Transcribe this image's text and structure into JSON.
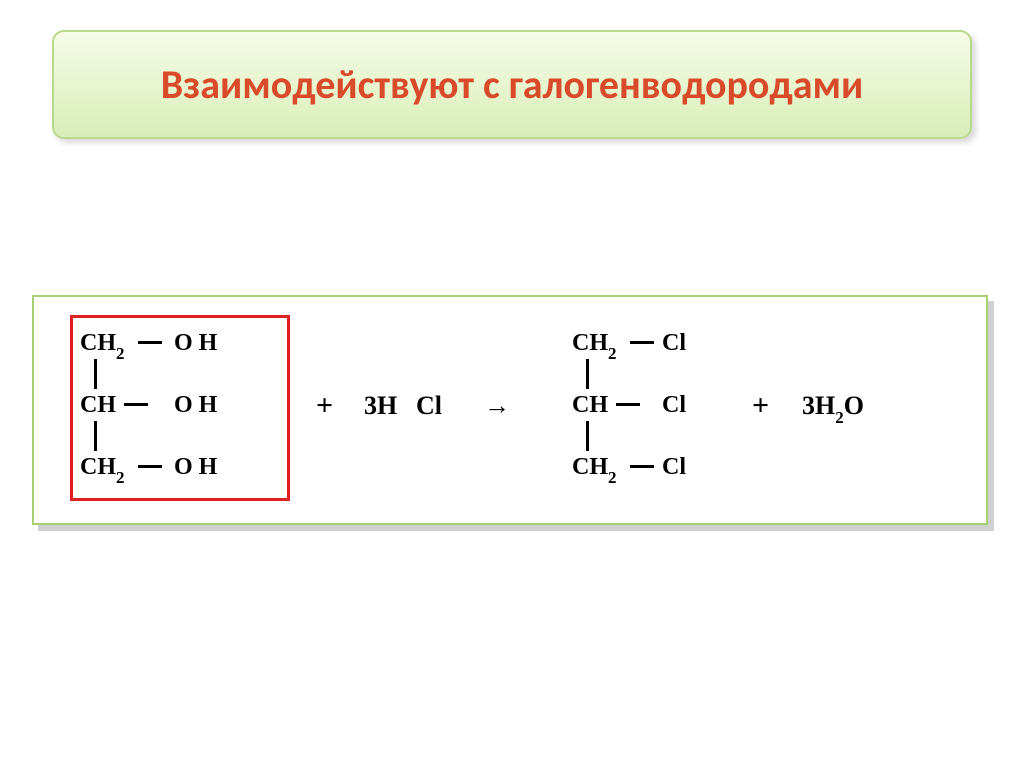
{
  "title": "Взаимодействуют с галогенводородами",
  "reactant1": {
    "c1": "CH",
    "c1_sub": "2",
    "c1_group": "O H",
    "c2": "CH",
    "c2_group": "O H",
    "c3": "CH",
    "c3_sub": "2",
    "c3_group": "O H"
  },
  "plus1": "+",
  "reagent": {
    "coeff": "3H",
    "rest": "Cl"
  },
  "arrow": "→",
  "product1": {
    "c1": "CH",
    "c1_sub": "2",
    "c1_group": "Cl",
    "c2": "CH",
    "c2_group": "Cl",
    "c3": "CH",
    "c3_sub": "2",
    "c3_group": "Cl"
  },
  "plus2": "+",
  "product2": {
    "coeff": "3H",
    "sub": "2",
    "rest": "O"
  }
}
